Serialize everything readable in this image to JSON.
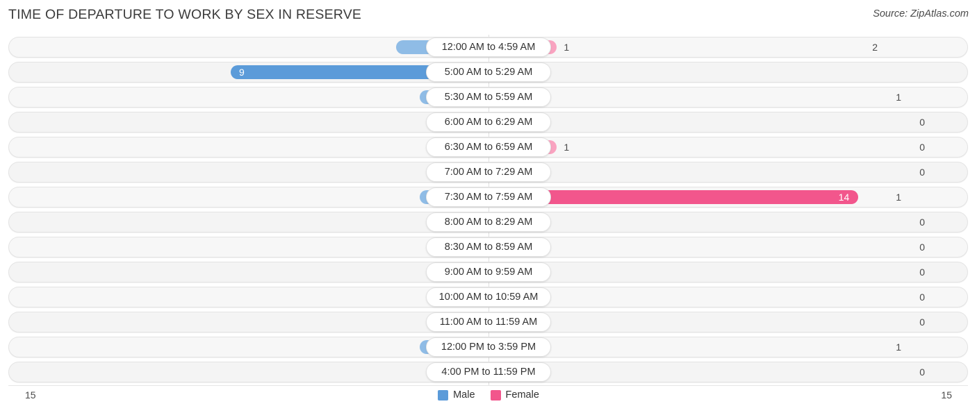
{
  "header": {
    "title": "TIME OF DEPARTURE TO WORK BY SEX IN RESERVE",
    "source": "Source: ZipAtlas.com"
  },
  "legend": {
    "male_label": "Male",
    "female_label": "Female",
    "male_color": "#5b9bd9",
    "female_color": "#f2568c"
  },
  "axis": {
    "left_label": "15",
    "right_label": "15",
    "max": 15
  },
  "chart_data": {
    "type": "bar",
    "orientation": "horizontal-diverging",
    "title": "TIME OF DEPARTURE TO WORK BY SEX IN RESERVE",
    "xlabel": "",
    "ylabel": "",
    "xlim": [
      15,
      15
    ],
    "grid": false,
    "legend_position": "bottom-center",
    "categories": [
      "12:00 AM to 4:59 AM",
      "5:00 AM to 5:29 AM",
      "5:30 AM to 5:59 AM",
      "6:00 AM to 6:29 AM",
      "6:30 AM to 6:59 AM",
      "7:00 AM to 7:29 AM",
      "7:30 AM to 7:59 AM",
      "8:00 AM to 8:29 AM",
      "8:30 AM to 8:59 AM",
      "9:00 AM to 9:59 AM",
      "10:00 AM to 10:59 AM",
      "11:00 AM to 11:59 AM",
      "12:00 PM to 3:59 PM",
      "4:00 PM to 11:59 PM"
    ],
    "series": [
      {
        "name": "Male",
        "color": "#8fbce6",
        "values": [
          2,
          9,
          1,
          0,
          0,
          0,
          1,
          0,
          0,
          0,
          0,
          0,
          1,
          0
        ],
        "labels": [
          "2",
          "9",
          "1",
          "0",
          "0",
          "0",
          "1",
          "0",
          "0",
          "0",
          "0",
          "0",
          "1",
          "0"
        ]
      },
      {
        "name": "Female",
        "color": "#f9a3c0",
        "values": [
          1,
          0,
          0,
          0,
          1,
          0,
          14,
          0,
          0,
          0,
          0,
          0,
          0,
          0
        ],
        "labels": [
          "1",
          "0",
          "0",
          "0",
          "1",
          "0",
          "14",
          "0",
          "0",
          "0",
          "0",
          "0",
          "0",
          "0"
        ]
      }
    ]
  }
}
